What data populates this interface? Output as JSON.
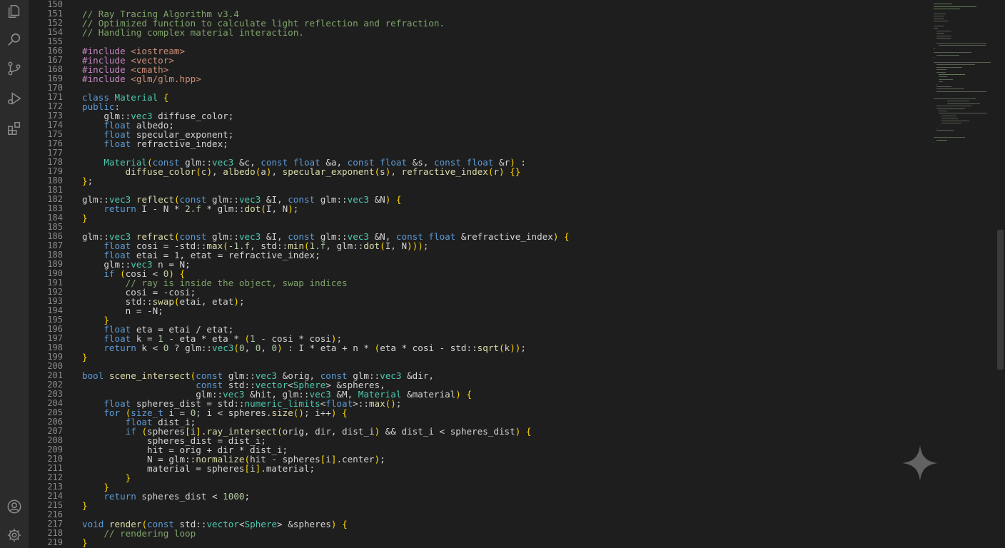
{
  "activity_bar": {
    "icons_top": [
      "files-icon",
      "search-icon",
      "source-control-icon",
      "run-debug-icon",
      "extensions-icon"
    ],
    "icons_bottom": [
      "account-icon",
      "settings-gear-icon"
    ]
  },
  "editor": {
    "language": "cpp",
    "lines": [
      {
        "n": "150",
        "t": ""
      },
      {
        "n": "151",
        "t": "// Ray Tracing Algorithm v3.4"
      },
      {
        "n": "152",
        "t": "// Optimized function to calculate light reflection and refraction."
      },
      {
        "n": "154",
        "t": "// Handling complex material interaction."
      },
      {
        "n": "155",
        "t": ""
      },
      {
        "n": "166",
        "t": "#include <iostream>"
      },
      {
        "n": "167",
        "t": "#include <vector>"
      },
      {
        "n": "168",
        "t": "#include <cmath>"
      },
      {
        "n": "169",
        "t": "#include <glm/glm.hpp>"
      },
      {
        "n": "170",
        "t": ""
      },
      {
        "n": "171",
        "t": "class Material {"
      },
      {
        "n": "172",
        "t": "public:"
      },
      {
        "n": "173",
        "t": "    glm::vec3 diffuse_color;"
      },
      {
        "n": "174",
        "t": "    float albedo;"
      },
      {
        "n": "175",
        "t": "    float specular_exponent;"
      },
      {
        "n": "176",
        "t": "    float refractive_index;"
      },
      {
        "n": "177",
        "t": ""
      },
      {
        "n": "178",
        "t": "    Material(const glm::vec3 &c, const float &a, const float &s, const float &r) :"
      },
      {
        "n": "179",
        "t": "        diffuse_color(c), albedo(a), specular_exponent(s), refractive_index(r) {}"
      },
      {
        "n": "180",
        "t": "};"
      },
      {
        "n": "181",
        "t": ""
      },
      {
        "n": "182",
        "t": "glm::vec3 reflect(const glm::vec3 &I, const glm::vec3 &N) {"
      },
      {
        "n": "183",
        "t": "    return I - N * 2.f * glm::dot(I, N);"
      },
      {
        "n": "184",
        "t": "}"
      },
      {
        "n": "185",
        "t": ""
      },
      {
        "n": "186",
        "t": "glm::vec3 refract(const glm::vec3 &I, const glm::vec3 &N, const float &refractive_index) {"
      },
      {
        "n": "187",
        "t": "    float cosi = -std::max(-1.f, std::min(1.f, glm::dot(I, N)));"
      },
      {
        "n": "188",
        "t": "    float etai = 1, etat = refractive_index;"
      },
      {
        "n": "189",
        "t": "    glm::vec3 n = N;"
      },
      {
        "n": "190",
        "t": "    if (cosi < 0) {"
      },
      {
        "n": "191",
        "t": "        // ray is inside the object, swap indices"
      },
      {
        "n": "192",
        "t": "        cosi = -cosi;"
      },
      {
        "n": "193",
        "t": "        std::swap(etai, etat);"
      },
      {
        "n": "194",
        "t": "        n = -N;"
      },
      {
        "n": "195",
        "t": "    }"
      },
      {
        "n": "196",
        "t": "    float eta = etai / etat;"
      },
      {
        "n": "197",
        "t": "    float k = 1 - eta * eta * (1 - cosi * cosi);"
      },
      {
        "n": "198",
        "t": "    return k < 0 ? glm::vec3(0, 0, 0) : I * eta + n * (eta * cosi - std::sqrt(k));"
      },
      {
        "n": "199",
        "t": "}"
      },
      {
        "n": "200",
        "t": ""
      },
      {
        "n": "201",
        "t": "bool scene_intersect(const glm::vec3 &orig, const glm::vec3 &dir,"
      },
      {
        "n": "202",
        "t": "                     const std::vector<Sphere> &spheres,"
      },
      {
        "n": "203",
        "t": "                     glm::vec3 &hit, glm::vec3 &M, Material &material) {"
      },
      {
        "n": "204",
        "t": "    float spheres_dist = std::numeric_limits<float>::max();"
      },
      {
        "n": "205",
        "t": "    for (size_t i = 0; i < spheres.size(); i++) {"
      },
      {
        "n": "206",
        "t": "        float dist_i;"
      },
      {
        "n": "207",
        "t": "        if (spheres[i].ray_intersect(orig, dir, dist_i) && dist_i < spheres_dist) {"
      },
      {
        "n": "208",
        "t": "            spheres_dist = dist_i;"
      },
      {
        "n": "209",
        "t": "            hit = orig + dir * dist_i;"
      },
      {
        "n": "210",
        "t": "            N = glm::normalize(hit - spheres[i].center);"
      },
      {
        "n": "211",
        "t": "            material = spheres[i].material;"
      },
      {
        "n": "212",
        "t": "        }"
      },
      {
        "n": "213",
        "t": "    }"
      },
      {
        "n": "214",
        "t": "    return spheres_dist < 1000;"
      },
      {
        "n": "215",
        "t": "}"
      },
      {
        "n": "216",
        "t": ""
      },
      {
        "n": "217",
        "t": "void render(const std::vector<Sphere> &spheres) {"
      },
      {
        "n": "218",
        "t": "    // rendering loop"
      },
      {
        "n": "219",
        "t": "}"
      }
    ]
  },
  "colors": {
    "background": "#1e1e1e",
    "activity_bar": "#2b2b2b",
    "comment": "#7fa46a",
    "keyword": "#5c9bd6",
    "type": "#4ec9b0",
    "function": "#dcdcaa",
    "preprocessor": "#c586c0",
    "string": "#ce9178",
    "bracket": "#ffd700",
    "number": "#b5cea8"
  }
}
